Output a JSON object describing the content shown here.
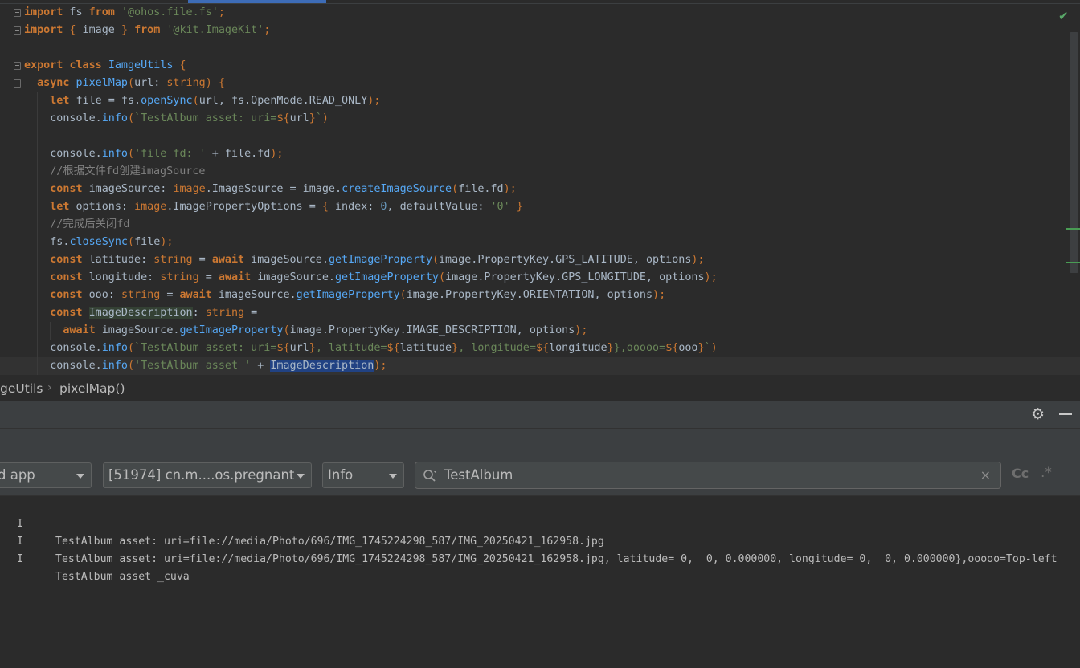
{
  "editor": {
    "lines": [
      "import fs from '@ohos.file.fs';",
      "import { image } from '@kit.ImageKit';",
      "",
      "export class IamgeUtils {",
      "  async pixelMap(url: string) {",
      "    let file = fs.openSync(url, fs.OpenMode.READ_ONLY);",
      "    console.info(`TestAlbum asset: uri=${url}`)",
      "",
      "    console.info('file fd: ' + file.fd);",
      "    //根据文件fd创建imagSource",
      "    const imageSource: image.ImageSource = image.createImageSource(file.fd);",
      "    let options: image.ImagePropertyOptions = { index: 0, defaultValue: '0' }",
      "    //完成后关闭fd",
      "    fs.closeSync(file);",
      "    const latitude: string = await imageSource.getImageProperty(image.PropertyKey.GPS_LATITUDE, options);",
      "    const longitude: string = await imageSource.getImageProperty(image.PropertyKey.GPS_LONGITUDE, options);",
      "    const ooo: string = await imageSource.getImageProperty(image.PropertyKey.ORIENTATION, options);",
      "    const ImageDescription: string =",
      "      await imageSource.getImageProperty(image.PropertyKey.IMAGE_DESCRIPTION, options);",
      "    console.info(`TestAlbum asset: uri=${url}, latitude=${latitude}, longitude=${longitude}},ooooo=${ooo}`)",
      "    console.info('TestAlbum asset ' + ImageDescription);"
    ]
  },
  "breadcrumb": {
    "class_name": "geUtils",
    "method_name": "pixelMap()",
    "separator": "›"
  },
  "toolbar": {
    "gear": "⚙",
    "app_filter": "d app",
    "process_filter": "[51974] cn.m....os.pregnant",
    "level_filter": "Info",
    "search_icon": "⚲",
    "search_value": "TestAlbum",
    "clear_icon": "×",
    "match_case": "Cc",
    "regex": ".*"
  },
  "log": [
    {
      "level": "I",
      "message": "TestAlbum asset: uri=file://media/Photo/696/IMG_1745224298_587/IMG_20250421_162958.jpg"
    },
    {
      "level": "I",
      "message": "TestAlbum asset: uri=file://media/Photo/696/IMG_1745224298_587/IMG_20250421_162958.jpg, latitude= 0,  0, 0.000000, longitude= 0,  0, 0.000000},ooooo=Top-left"
    },
    {
      "level": "I",
      "message": "TestAlbum asset _cuva"
    }
  ],
  "status": {
    "check_icon": "✔"
  }
}
